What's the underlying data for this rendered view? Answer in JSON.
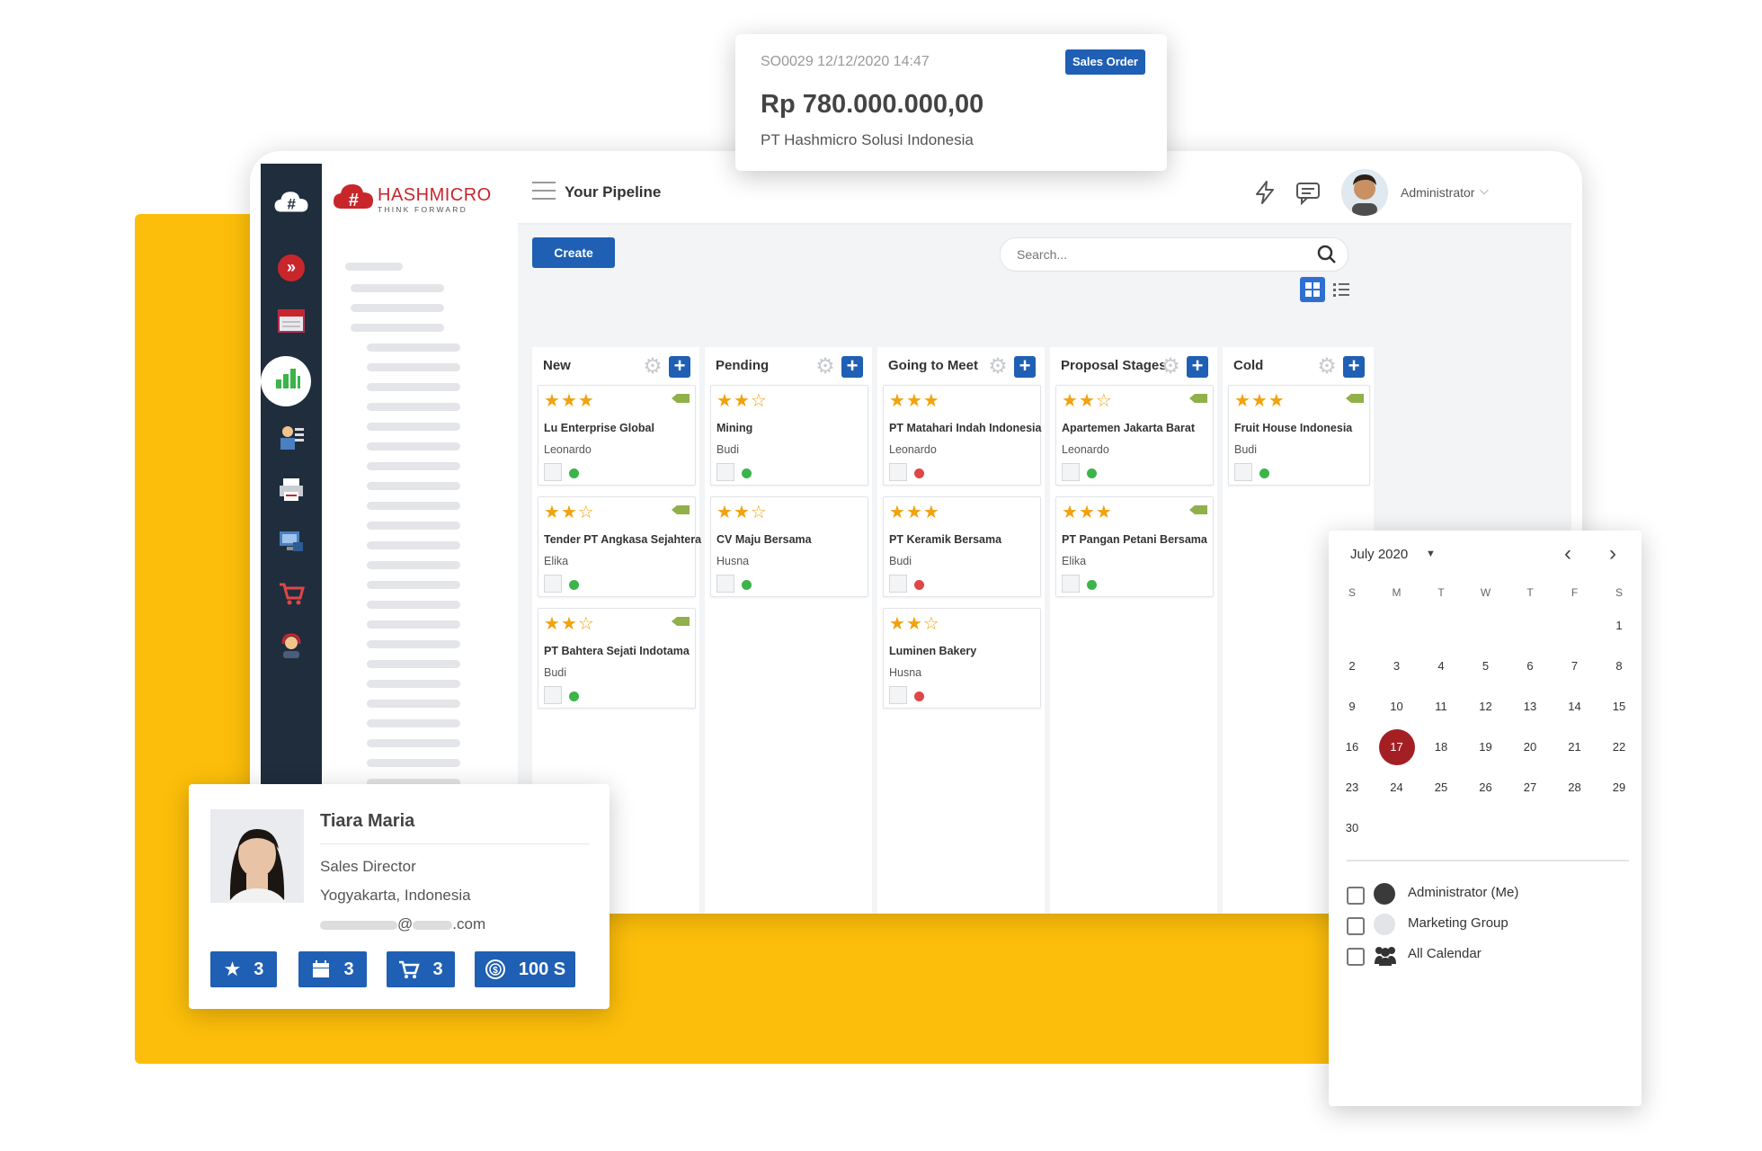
{
  "logo": {
    "brand": "HASHMICRO",
    "tagline": "THINK FORWARD"
  },
  "header": {
    "title": "Your Pipeline",
    "user": "Administrator"
  },
  "toolbar": {
    "create_label": "Create",
    "search_placeholder": "Search..."
  },
  "columns": [
    {
      "name": "New",
      "cards": [
        {
          "stars": 3,
          "title": "Lu Enterprise Global",
          "person": "Leonardo",
          "status": "green",
          "tag": true
        },
        {
          "stars": 2,
          "title": "Tender PT Angkasa Sejahtera",
          "person": "Elika",
          "status": "green",
          "tag": true
        },
        {
          "stars": 2,
          "title": "PT Bahtera Sejati Indotama",
          "person": "Budi",
          "status": "green",
          "tag": true
        }
      ]
    },
    {
      "name": "Pending",
      "cards": [
        {
          "stars": 2,
          "title": "Mining",
          "person": "Budi",
          "status": "green",
          "tag": false
        },
        {
          "stars": 2,
          "title": "CV Maju Bersama",
          "person": "Husna",
          "status": "green",
          "tag": false
        }
      ]
    },
    {
      "name": "Going to Meet",
      "cards": [
        {
          "stars": 3,
          "title": "PT Matahari Indah Indonesia",
          "person": "Leonardo",
          "status": "red",
          "tag": false
        },
        {
          "stars": 3,
          "title": "PT Keramik Bersama",
          "person": "Budi",
          "status": "red",
          "tag": false
        },
        {
          "stars": 2,
          "title": "Luminen Bakery",
          "person": "Husna",
          "status": "red",
          "tag": false
        }
      ]
    },
    {
      "name": "Proposal Stages",
      "cards": [
        {
          "stars": 2,
          "title": "Apartemen Jakarta Barat",
          "person": "Leonardo",
          "status": "green",
          "tag": true
        },
        {
          "stars": 3,
          "title": "PT Pangan Petani Bersama",
          "person": "Elika",
          "status": "green",
          "tag": true
        }
      ]
    },
    {
      "name": "Cold",
      "cards": [
        {
          "stars": 3,
          "title": "Fruit House Indonesia",
          "person": "Budi",
          "status": "green",
          "tag": true
        }
      ]
    }
  ],
  "sales_order": {
    "ref": "SO0029 12/12/2020 14:47",
    "badge": "Sales Order",
    "amount": "Rp 780.000.000,00",
    "company": "PT Hashmicro Solusi Indonesia"
  },
  "contact": {
    "name": "Tiara Maria",
    "role": "Sales Director",
    "location": "Yogyakarta, Indonesia",
    "email_at": "@",
    "email_suffix": ".com",
    "badges": [
      {
        "icon": "star-icon",
        "value": "3"
      },
      {
        "icon": "calendar-icon",
        "value": "3"
      },
      {
        "icon": "cart-icon",
        "value": "3"
      },
      {
        "icon": "coin-icon",
        "value": "100 S"
      }
    ]
  },
  "calendar": {
    "month": "July 2020",
    "weekdays": [
      "S",
      "M",
      "T",
      "W",
      "T",
      "F",
      "S"
    ],
    "selected": "17",
    "weeks": [
      [
        "",
        "",
        "",
        "",
        "",
        "",
        "1"
      ],
      [
        "2",
        "3",
        "4",
        "5",
        "6",
        "7",
        "8"
      ],
      [
        "9",
        "10",
        "11",
        "12",
        "13",
        "14",
        "15"
      ],
      [
        "16",
        "17",
        "18",
        "19",
        "20",
        "21",
        "22"
      ],
      [
        "23",
        "24",
        "25",
        "26",
        "27",
        "28",
        "29"
      ],
      [
        "30",
        "",
        "",
        "",
        "",
        "",
        ""
      ]
    ],
    "filters": [
      {
        "label": "Administrator (Me)"
      },
      {
        "label": "Marketing Group"
      },
      {
        "label": "All Calendar"
      }
    ]
  },
  "colors": {
    "accent": "#1f5fb4",
    "yellow": "#FCBE0A",
    "sidebar": "#1f2d3d",
    "selected_day": "#a31f24",
    "star": "#f1a20f",
    "green": "#3bb44a",
    "red": "#e04646"
  }
}
